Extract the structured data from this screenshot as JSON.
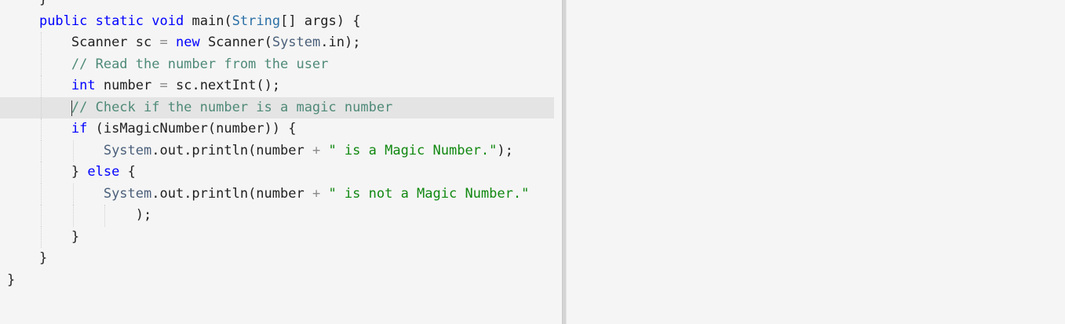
{
  "editor": {
    "lines": [
      {
        "indent": 1,
        "tokens": [
          {
            "t": "}",
            "c": "plain"
          }
        ]
      },
      {
        "indent": 1,
        "tokens": [
          {
            "t": "public",
            "c": "kw"
          },
          {
            "t": " ",
            "c": "plain"
          },
          {
            "t": "static",
            "c": "kw"
          },
          {
            "t": " ",
            "c": "plain"
          },
          {
            "t": "void",
            "c": "kw"
          },
          {
            "t": " main(",
            "c": "plain"
          },
          {
            "t": "String",
            "c": "type"
          },
          {
            "t": "[] args) {",
            "c": "plain"
          }
        ]
      },
      {
        "indent": 2,
        "tokens": [
          {
            "t": "Scanner sc ",
            "c": "plain"
          },
          {
            "t": "=",
            "c": "op"
          },
          {
            "t": " ",
            "c": "plain"
          },
          {
            "t": "new",
            "c": "kw"
          },
          {
            "t": " Scanner(",
            "c": "plain"
          },
          {
            "t": "System",
            "c": "sys"
          },
          {
            "t": ".in);",
            "c": "plain"
          }
        ]
      },
      {
        "indent": 2,
        "tokens": [
          {
            "t": "// Read the number from the user",
            "c": "cm"
          }
        ]
      },
      {
        "indent": 2,
        "tokens": [
          {
            "t": "int",
            "c": "kw"
          },
          {
            "t": " number ",
            "c": "plain"
          },
          {
            "t": "=",
            "c": "op"
          },
          {
            "t": " sc.nextInt();",
            "c": "plain"
          }
        ]
      },
      {
        "indent": 2,
        "current": true,
        "tokens": [
          {
            "t": "// Check if the number is a magic number",
            "c": "cm"
          }
        ]
      },
      {
        "indent": 2,
        "tokens": [
          {
            "t": "if",
            "c": "kw"
          },
          {
            "t": " (isMagicNumber(number)) {",
            "c": "plain"
          }
        ]
      },
      {
        "indent": 3,
        "tokens": [
          {
            "t": "System",
            "c": "sys"
          },
          {
            "t": ".out.println(number ",
            "c": "plain"
          },
          {
            "t": "+",
            "c": "op"
          },
          {
            "t": " ",
            "c": "plain"
          },
          {
            "t": "\" is a Magic Number.\"",
            "c": "str"
          },
          {
            "t": ");",
            "c": "plain"
          }
        ]
      },
      {
        "indent": 2,
        "tokens": [
          {
            "t": "} ",
            "c": "plain"
          },
          {
            "t": "else",
            "c": "kw"
          },
          {
            "t": " {",
            "c": "plain"
          }
        ]
      },
      {
        "indent": 3,
        "tokens": [
          {
            "t": "System",
            "c": "sys"
          },
          {
            "t": ".out.println(number ",
            "c": "plain"
          },
          {
            "t": "+",
            "c": "op"
          },
          {
            "t": " ",
            "c": "plain"
          },
          {
            "t": "\" is not a Magic Number.\"",
            "c": "str"
          }
        ]
      },
      {
        "indent": 4,
        "tokens": [
          {
            "t": ");",
            "c": "plain"
          }
        ]
      },
      {
        "indent": 2,
        "tokens": [
          {
            "t": "}",
            "c": "plain"
          }
        ]
      },
      {
        "indent": 1,
        "tokens": [
          {
            "t": "}",
            "c": "plain"
          }
        ]
      },
      {
        "indent": 0,
        "tokens": [
          {
            "t": "}",
            "c": "plain"
          }
        ]
      }
    ]
  }
}
